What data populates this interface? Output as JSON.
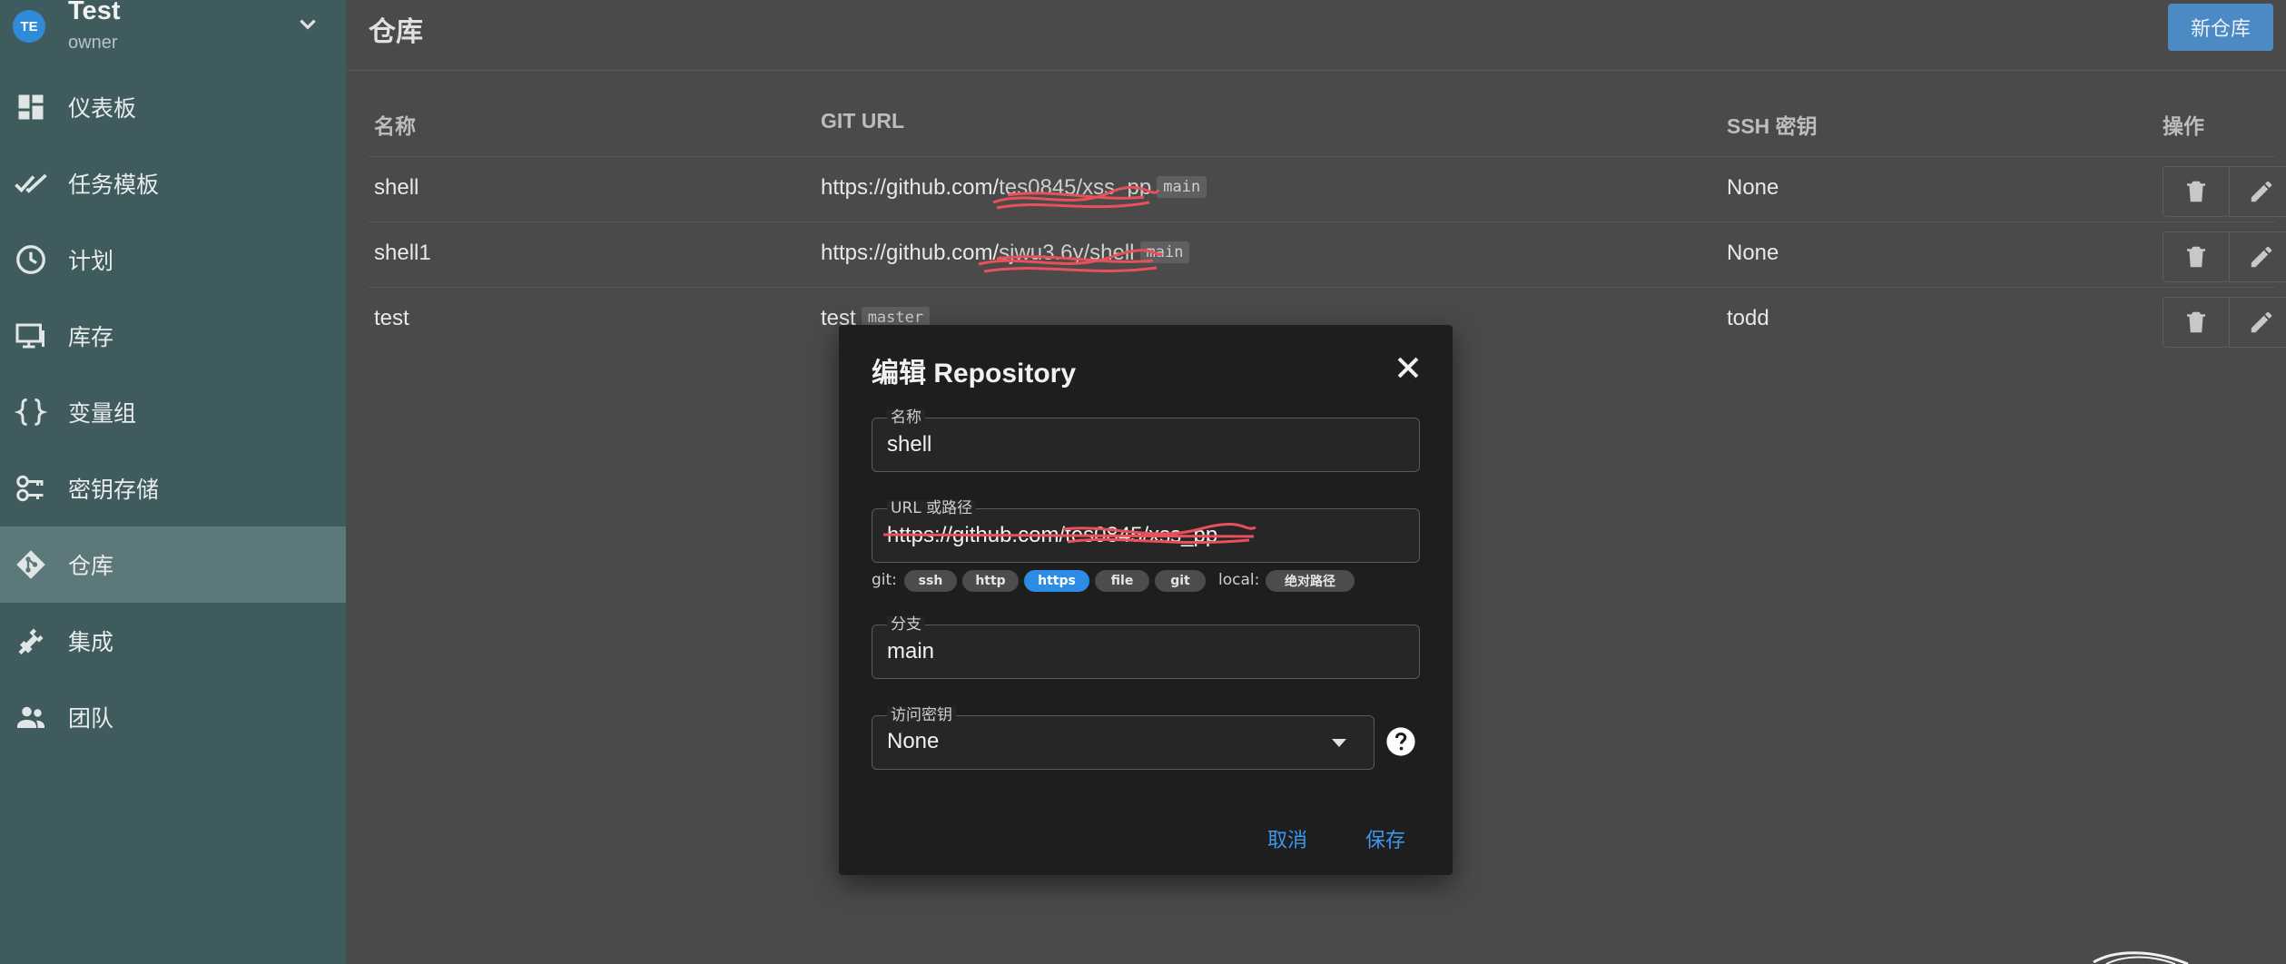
{
  "sidebar": {
    "team": {
      "initials": "TE",
      "name": "Test",
      "role": "owner"
    },
    "items": [
      {
        "label": "仪表板",
        "icon": "dashboard-icon"
      },
      {
        "label": "任务模板",
        "icon": "double-check-icon"
      },
      {
        "label": "计划",
        "icon": "clock-icon"
      },
      {
        "label": "库存",
        "icon": "monitor-icon"
      },
      {
        "label": "变量组",
        "icon": "braces-icon"
      },
      {
        "label": "密钥存储",
        "icon": "keys-icon"
      },
      {
        "label": "仓库",
        "icon": "git-icon",
        "active": true
      },
      {
        "label": "集成",
        "icon": "plug-icon"
      },
      {
        "label": "团队",
        "icon": "people-icon"
      }
    ]
  },
  "header": {
    "title": "仓库",
    "new_button": "新仓库"
  },
  "table": {
    "columns": {
      "name": "名称",
      "git_url": "GIT URL",
      "ssh_key": "SSH 密钥",
      "actions": "操作"
    },
    "rows": [
      {
        "name": "shell",
        "url": "https://github.com/",
        "url_hidden": "tes0845/xss_pp",
        "branch": "main",
        "ssh_key": "None"
      },
      {
        "name": "shell1",
        "url": "https://github.com/",
        "url_hidden": "sjwu3.6y/shell",
        "branch": "main",
        "ssh_key": "None"
      },
      {
        "name": "test",
        "url": "test",
        "url_hidden": "",
        "branch": "master",
        "ssh_key": "todd"
      }
    ]
  },
  "dialog": {
    "title": "编辑 Repository",
    "name_label": "名称",
    "name_value": "shell",
    "url_label": "URL 或路径",
    "url_value": "https://github.com/tes0845/xss_pp",
    "git_label": "git:",
    "protocols": [
      "ssh",
      "http",
      "https",
      "file",
      "git"
    ],
    "active_protocol": "https",
    "local_label": "local:",
    "local_option": "绝对路径",
    "branch_label": "分支",
    "branch_value": "main",
    "key_label": "访问密钥",
    "key_value": "None",
    "cancel": "取消",
    "save": "保存"
  },
  "colors": {
    "accent": "#2d8ce6",
    "sidebar": "#3f5b5e",
    "redaction": "#e8505b"
  }
}
